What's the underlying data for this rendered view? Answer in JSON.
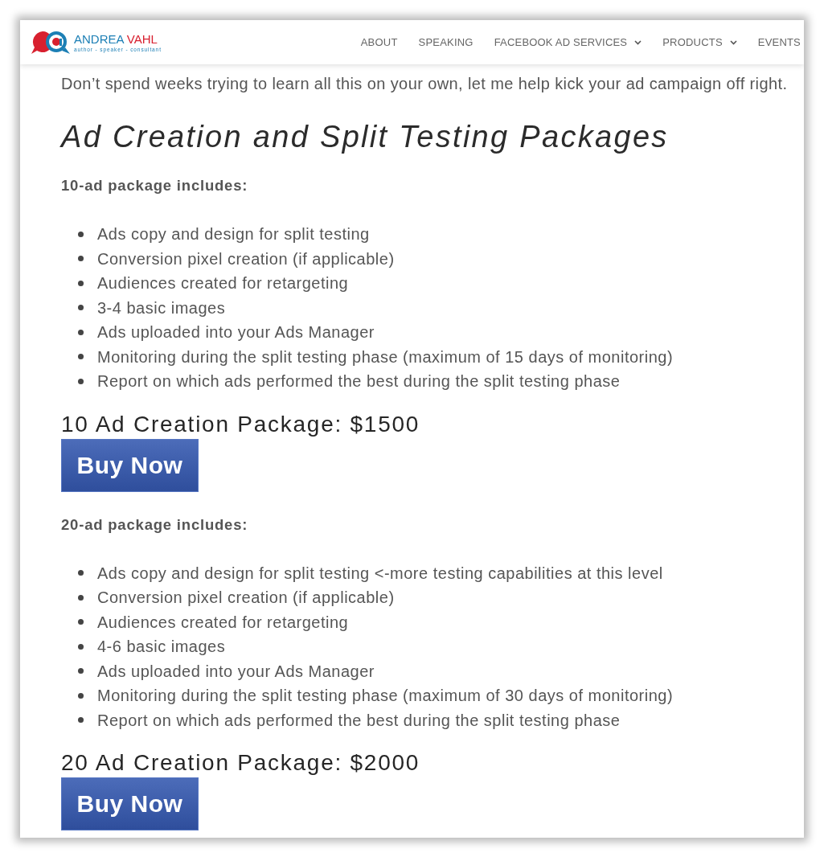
{
  "header": {
    "logo": {
      "first_name": "ANDREA",
      "last_name": "VAHL",
      "tagline": "author - speaker - consultant"
    },
    "nav": [
      {
        "label": "ABOUT",
        "has_dropdown": false
      },
      {
        "label": "SPEAKING",
        "has_dropdown": false
      },
      {
        "label": "FACEBOOK AD SERVICES",
        "has_dropdown": true
      },
      {
        "label": "PRODUCTS",
        "has_dropdown": true
      },
      {
        "label": "EVENTS",
        "has_dropdown": false
      }
    ]
  },
  "intro": "Don’t spend weeks trying to learn all this on your own, let me help kick your ad campaign off right.",
  "title": "Ad Creation and Split Testing Packages",
  "packages": [
    {
      "heading": "10-ad package includes:",
      "features": [
        "Ads copy and design for split testing",
        "Conversion pixel creation (if applicable)",
        "Audiences created for retargeting",
        "3-4 basic images",
        "Ads uploaded into your Ads Manager",
        "Monitoring during the split testing phase (maximum of 15 days of monitoring)",
        "Report on which ads performed the best during the split testing phase"
      ],
      "price_heading": "10 Ad Creation Package: $1500",
      "button": "Buy Now"
    },
    {
      "heading": "20-ad package includes:",
      "features": [
        "Ads copy and design for split testing <-more testing capabilities at this level",
        "Conversion pixel creation (if applicable)",
        "Audiences created for retargeting",
        "4-6 basic images",
        "Ads uploaded into your Ads Manager",
        "Monitoring during the split testing phase (maximum of 30 days of monitoring)",
        "Report on which ads performed the best during the split testing phase"
      ],
      "price_heading": "20 Ad Creation Package: $2000",
      "button": "Buy Now"
    }
  ]
}
